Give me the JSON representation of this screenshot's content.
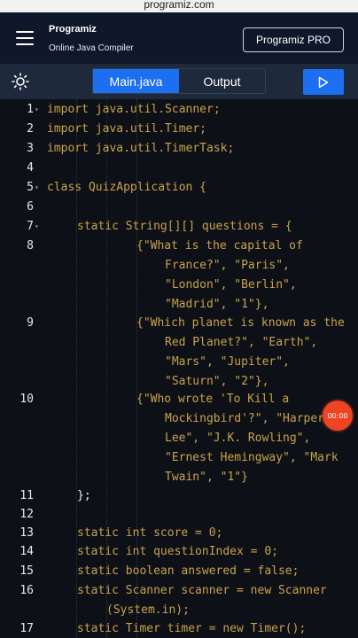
{
  "browser": {
    "url": "programiz.com"
  },
  "header": {
    "logo_text": "Programiz",
    "subtitle": "Online Java Compiler",
    "pro_button": "Programiz PRO"
  },
  "toolbar": {
    "theme_icon": "sun-icon",
    "tabs": [
      "Main.java",
      "Output"
    ],
    "active_tab": "Main.java",
    "run_icon": "play-icon"
  },
  "colors": {
    "accent": "#1d6ff2",
    "keyword": "#c9a14a",
    "number": "#ff7b72",
    "record": "#ef4423"
  },
  "editor": {
    "line_numbers": [
      "1",
      "2",
      "3",
      "4",
      "5",
      "6",
      "7",
      "8",
      "9",
      "10",
      "11",
      "12",
      "13",
      "14",
      "15",
      "16",
      "17"
    ],
    "lines": [
      "import java.util.Scanner;",
      "import java.util.Timer;",
      "import java.util.TimerTask;",
      "",
      "class QuizApplication {",
      "",
      "static String[][] questions = {",
      "{\"What is the capital of",
      "France?\", \"Paris\",",
      "\"London\", \"Berlin\",",
      "\"Madrid\", \"1\"},",
      "{\"Which planet is known as the",
      "Red Planet?\", \"Earth\",",
      "\"Mars\", \"Jupiter\",",
      "\"Saturn\", \"2\"},",
      "{\"Who wrote 'To Kill a",
      "Mockingbird'?\", \"Harper",
      "Lee\", \"J.K. Rowling\",",
      "\"Ernest Hemingway\", \"Mark",
      "Twain\", \"1\"}",
      "};",
      "",
      "static int score = 0;",
      "static int questionIndex = 0;",
      "static boolean answered = false;",
      "static Scanner scanner = new Scanner",
      "(System.in);",
      "static Timer timer = new Timer();"
    ]
  },
  "recording": {
    "time": "00:00"
  }
}
